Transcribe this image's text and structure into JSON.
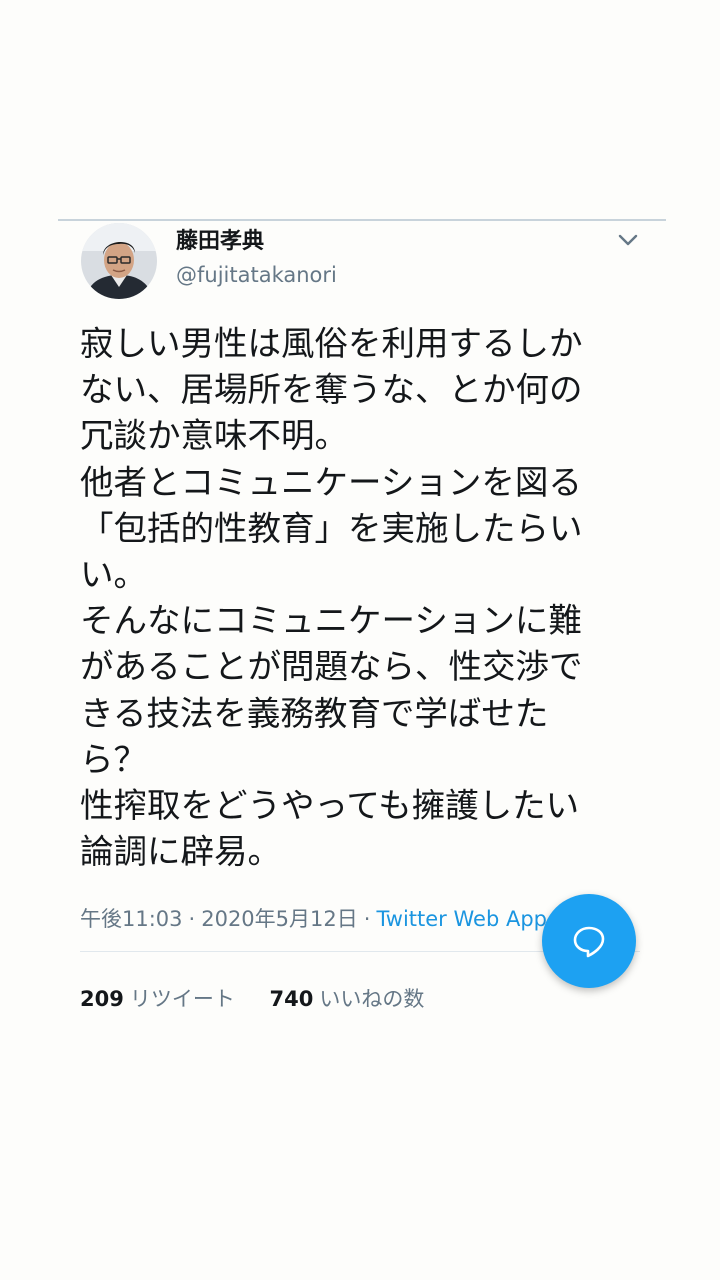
{
  "author": {
    "name": "藤田孝典",
    "handle": "@fujitatakanori"
  },
  "tweet": {
    "lines": [
      "寂しい男性は風俗を利用するしか",
      "ない、居場所を奪うな、とか何の",
      "冗談か意味不明。",
      "他者とコミュニケーションを図る",
      "「包括的性教育」を実施したらい",
      "い。",
      "そんなにコミュニケーションに難",
      "があることが問題なら、性交渉で",
      "きる技法を義務教育で学ばせた",
      "ら？",
      "性搾取をどうやっても擁護したい",
      "論調に辟易。"
    ]
  },
  "meta": {
    "time": "午後11:03",
    "separator": "·",
    "date": "2020年5月12日",
    "source": "Twitter Web App"
  },
  "stats": {
    "retweets_count": "209",
    "retweets_label": "リツイート",
    "likes_count": "740",
    "likes_label": "いいねの数"
  },
  "icons": {
    "menu": "chevron-down-icon",
    "compose": "speech-bubble-icon"
  },
  "colors": {
    "text": "#14171a",
    "secondary": "#657786",
    "link": "#1b95e0",
    "fab": "#1da1f2"
  }
}
